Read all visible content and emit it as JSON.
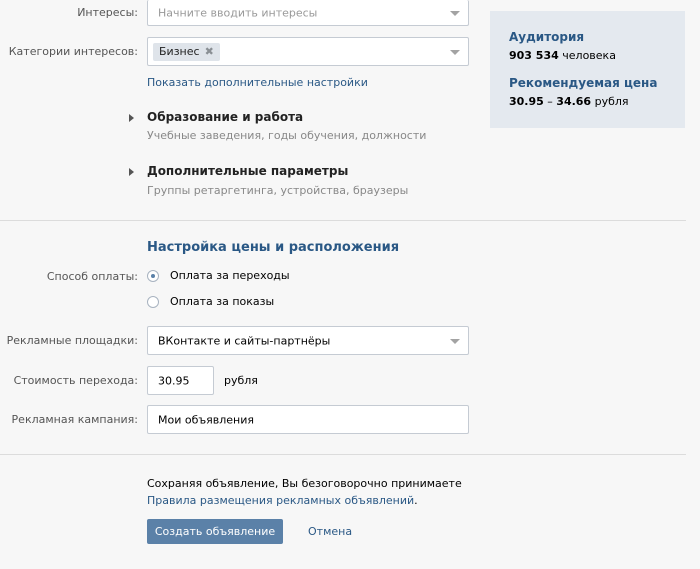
{
  "targeting": {
    "interests_label": "Интересы:",
    "interests_placeholder": "Начните вводить интересы",
    "categories_label": "Категории интересов:",
    "category_chip": "Бизнес",
    "chip_remove": "✖",
    "more_settings_link": "Показать дополнительные настройки",
    "sections": [
      {
        "title": "Образование и работа",
        "subtitle": "Учебные заведения, годы обучения, должности"
      },
      {
        "title": "Дополнительные параметры",
        "subtitle": "Группы ретаргетинга, устройства, браузеры"
      }
    ]
  },
  "pricing": {
    "heading": "Настройка цены и расположения",
    "payment_label": "Способ оплаты:",
    "payment_options": [
      {
        "label": "Оплата за переходы",
        "selected": true
      },
      {
        "label": "Оплата за показы",
        "selected": false
      }
    ],
    "platforms_label": "Рекламные площадки:",
    "platforms_value": "ВКонтакте и сайты-партнёры",
    "cost_label": "Стоимость перехода:",
    "cost_value": "30.95",
    "cost_unit": "рубля",
    "campaign_label": "Рекламная кампания:",
    "campaign_value": "Мои объявления"
  },
  "footer": {
    "agreement_text": "Сохраняя объявление, Вы безоговорочно принимаете",
    "rules_link": "Правила размещения рекламных объявлений",
    "rules_period": ".",
    "create_button": "Создать объявление",
    "cancel_link": "Отмена"
  },
  "sidebar": {
    "audience_title": "Аудитория",
    "audience_count": "903 534",
    "audience_unit": "человека",
    "price_title": "Рекомендуемая цена",
    "price_from": "30.95",
    "price_dash": "–",
    "price_to": "34.66",
    "price_unit": "рубля"
  },
  "colors": {
    "accent": "#2a5885",
    "button": "#5b81a8",
    "panel": "#e4e9ef"
  }
}
